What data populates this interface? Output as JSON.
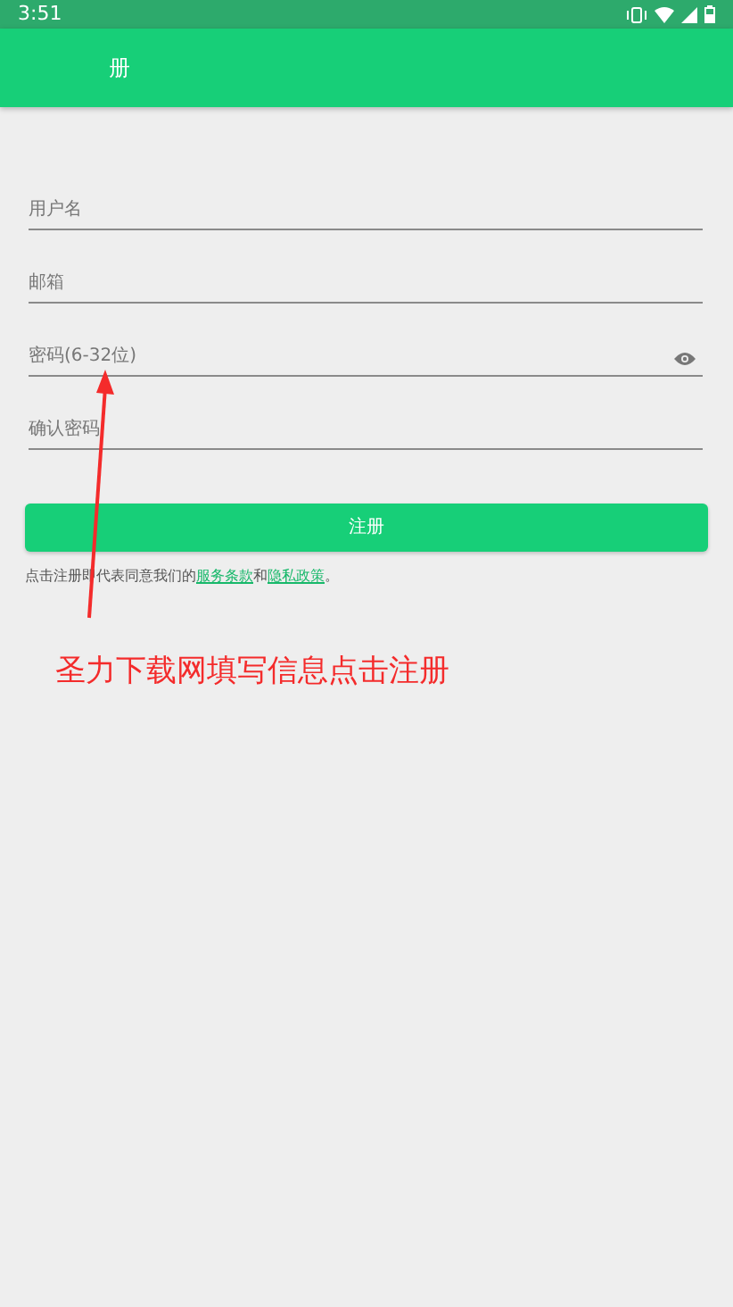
{
  "status_bar": {
    "time": "3:51"
  },
  "app_bar": {
    "title": "册"
  },
  "fields": [
    {
      "placeholder": "用户名",
      "kind": "text"
    },
    {
      "placeholder": "邮箱",
      "kind": "text"
    },
    {
      "placeholder": "密码(6-32位)",
      "kind": "password"
    },
    {
      "placeholder": "确认密码",
      "kind": "text"
    }
  ],
  "submit_button": "注册",
  "terms": {
    "prefix": "点击注册即代表同意我们的",
    "link_1": "服务条款",
    "middle": "和",
    "link_2": "隐私政策",
    "suffix": "。"
  },
  "annotation": {
    "text": "圣力下载网填写信息点击注册"
  }
}
